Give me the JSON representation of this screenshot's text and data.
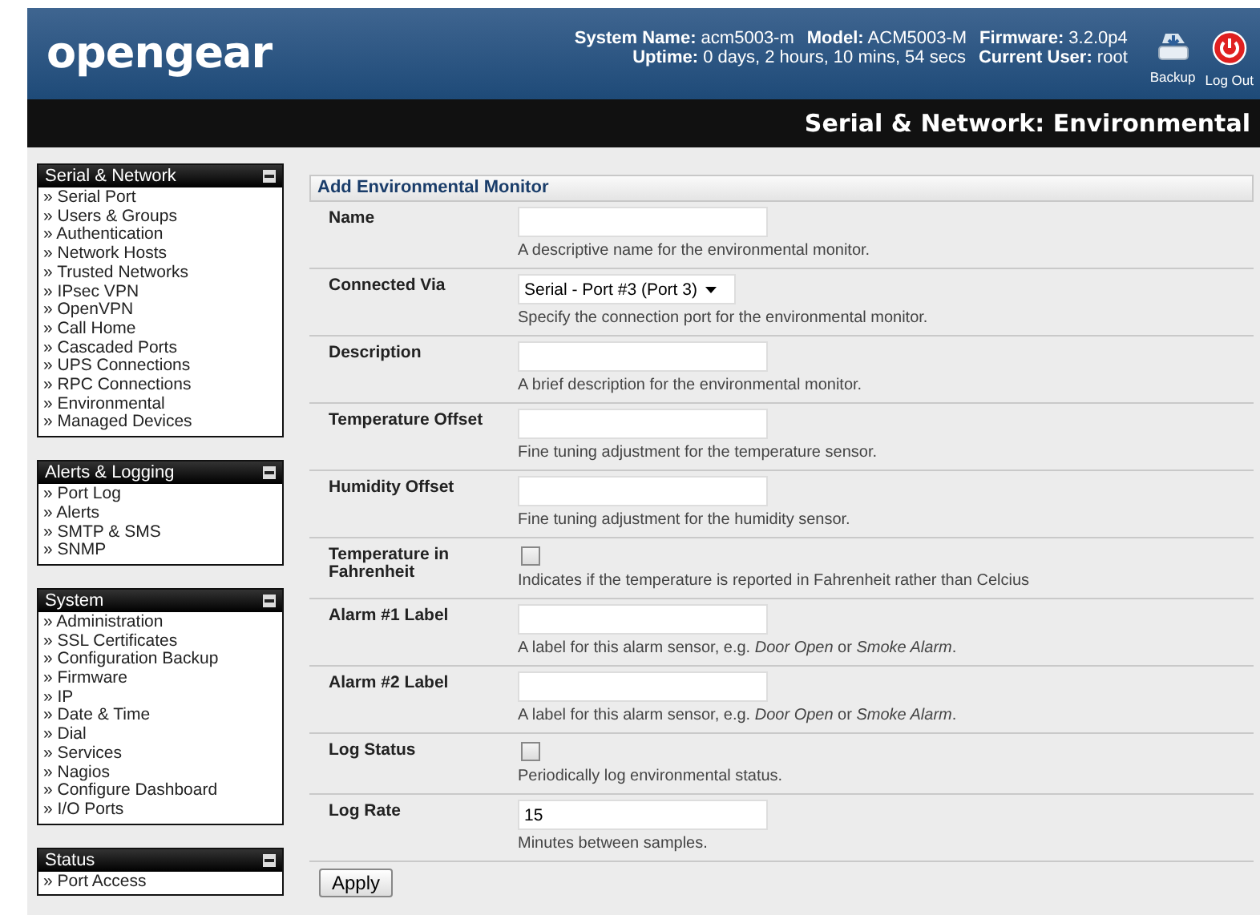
{
  "header": {
    "logo": "opengear",
    "info": [
      [
        {
          "label": "System Name:",
          "value": "acm5003-m"
        },
        {
          "label": "Model:",
          "value": "ACM5003-M"
        },
        {
          "label": "Firmware:",
          "value": "3.2.0p4"
        }
      ],
      [
        {
          "label": "Uptime:",
          "value": "0 days, 2 hours, 10 mins, 54 secs"
        },
        {
          "label": "Current User:",
          "value": "root"
        }
      ]
    ],
    "actions": [
      {
        "kind": "backup",
        "label": "Backup"
      },
      {
        "kind": "logout",
        "label": "Log Out"
      }
    ]
  },
  "page_title": "Serial & Network: Environmental",
  "sidebar": [
    {
      "title": "Serial & Network",
      "items": [
        "» Serial Port",
        "» Users & Groups",
        "» Authentication",
        "» Network Hosts",
        "» Trusted Networks",
        "» IPsec VPN",
        "» OpenVPN",
        "» Call Home",
        "» Cascaded Ports",
        "» UPS Connections",
        "» RPC Connections",
        "» Environmental",
        "» Managed Devices"
      ]
    },
    {
      "title": "Alerts & Logging",
      "items": [
        "» Port Log",
        "» Alerts",
        "» SMTP & SMS",
        "» SNMP"
      ]
    },
    {
      "title": "System",
      "items": [
        "» Administration",
        "» SSL Certificates",
        "» Configuration Backup",
        "» Firmware",
        "» IP",
        "» Date & Time",
        "» Dial",
        "» Services",
        "» Nagios",
        "» Configure Dashboard",
        "» I/O Ports"
      ]
    },
    {
      "title": "Status",
      "items": [
        "» Port Access"
      ]
    }
  ],
  "form": {
    "title": "Add Environmental Monitor",
    "rows": [
      {
        "kind": "text",
        "label": "Name",
        "hint": "A descriptive name for the environmental monitor."
      },
      {
        "kind": "select",
        "label": "Connected Via",
        "value": "Serial - Port #3 (Port 3)",
        "hint": "Specify the connection port for the environmental monitor."
      },
      {
        "kind": "text",
        "label": "Description",
        "hint": "A brief description for the environmental monitor."
      },
      {
        "kind": "text",
        "label": "Temperature Offset",
        "hint": "Fine tuning adjustment for the temperature sensor."
      },
      {
        "kind": "text",
        "label": "Humidity Offset",
        "hint": "Fine tuning adjustment for the humidity sensor."
      },
      {
        "kind": "checkbox",
        "label": "Temperature in Fahrenheit",
        "checked": false,
        "hint": "Indicates if the temperature is reported in Fahrenheit rather than Celcius"
      },
      {
        "kind": "text",
        "label": "Alarm #1 Label",
        "hint": "A label for this alarm sensor, e.g. *Door Open* or *Smoke Alarm*."
      },
      {
        "kind": "text",
        "label": "Alarm #2 Label",
        "hint": "A label for this alarm sensor, e.g. *Door Open* or *Smoke Alarm*."
      },
      {
        "kind": "checkbox",
        "label": "Log Status",
        "checked": false,
        "hint": "Periodically log environmental status."
      },
      {
        "kind": "text",
        "label": "Log Rate",
        "value": "15",
        "hint": "Minutes between samples."
      }
    ],
    "button": "Apply"
  }
}
